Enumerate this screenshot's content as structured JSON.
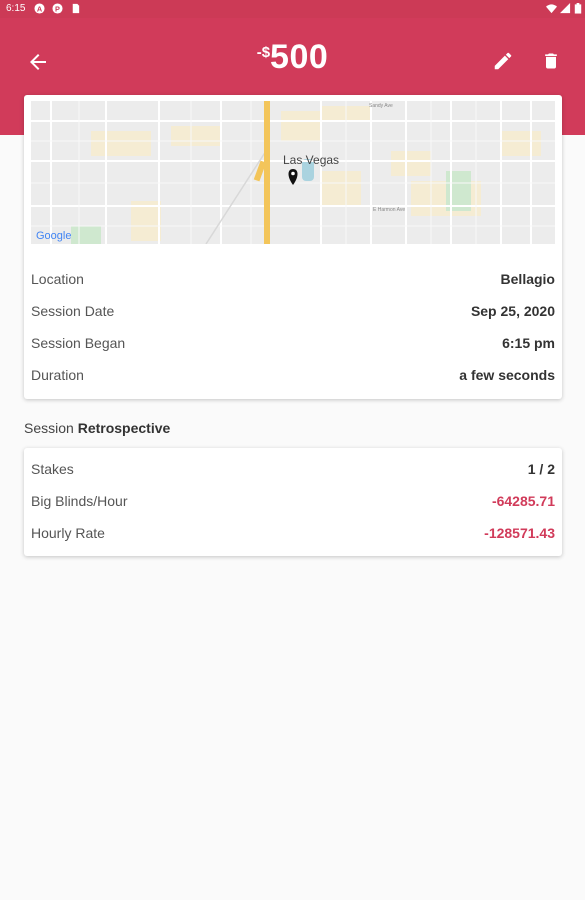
{
  "status_bar": {
    "time": "6:15",
    "icons": [
      "a-icon",
      "p-icon",
      "sim-icon",
      "wifi-icon",
      "signal-icon",
      "battery-icon"
    ]
  },
  "header": {
    "amount_sign": "-$",
    "amount": "500",
    "actions": [
      "back-arrow-icon",
      "edit-pencil-icon",
      "delete-trash-icon"
    ],
    "color": "#d13b5a"
  },
  "map": {
    "city_label": "Las Vegas",
    "attribution": "Google",
    "streets": [
      "Sandy Ave",
      "E Harmon Ave"
    ]
  },
  "details": [
    {
      "label": "Location",
      "value": "Bellagio"
    },
    {
      "label": "Session Date",
      "value": "Sep 25, 2020"
    },
    {
      "label": "Session Began",
      "value": "6:15 pm"
    },
    {
      "label": "Duration",
      "value": "a few seconds"
    }
  ],
  "retrospective": {
    "title_prefix": "Session",
    "title_bold": "Retrospective",
    "rows": [
      {
        "label": "Stakes",
        "value": "1 / 2"
      },
      {
        "label": "Big Blinds/Hour",
        "value": "-64285.71"
      },
      {
        "label": "Hourly Rate",
        "value": "-128571.43"
      }
    ]
  },
  "colors": {
    "accent": "#d13b5a",
    "negative": "#d13b5a",
    "background": "#fafafa"
  }
}
